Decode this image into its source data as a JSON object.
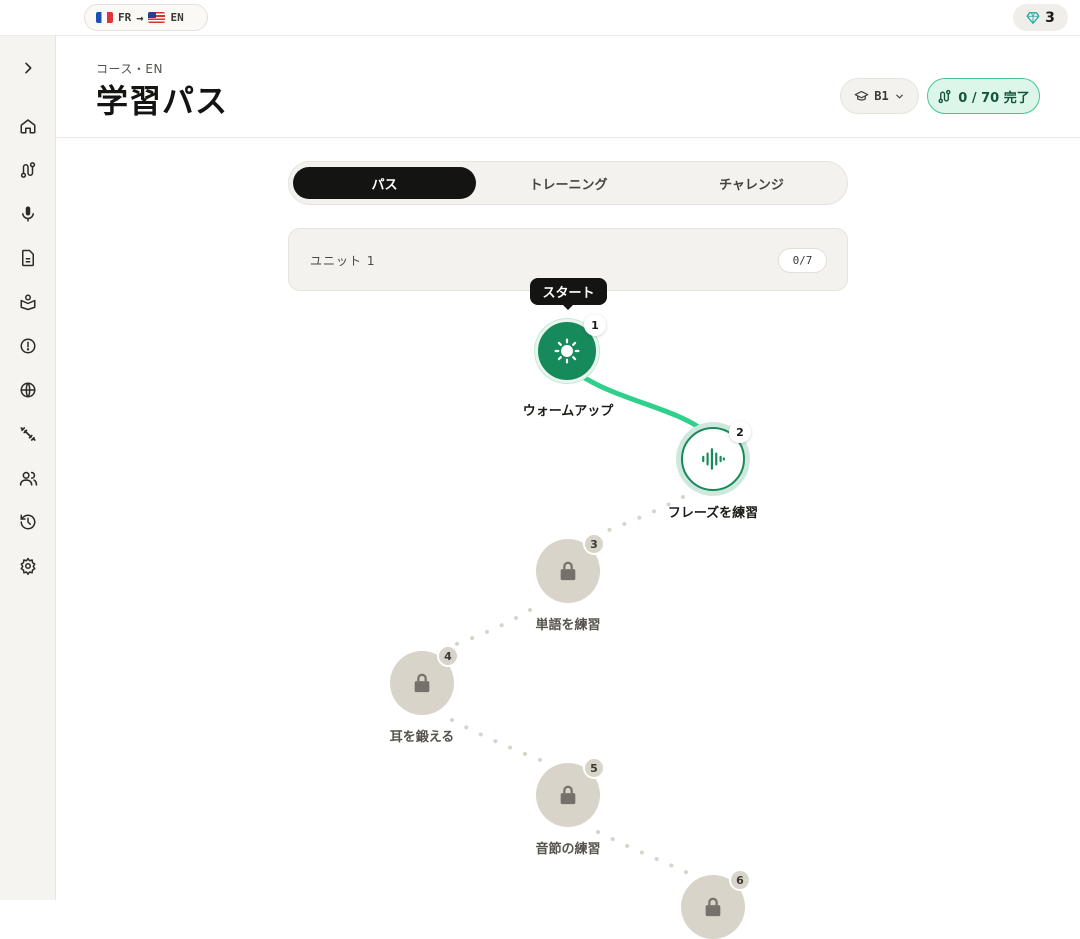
{
  "topbar": {
    "source_lang": "FR",
    "target_lang": "EN",
    "arrow": "→",
    "gems_count": "3"
  },
  "sidebar": {
    "items": [
      {
        "icon": "chevron-right-icon"
      },
      {
        "icon": "home-icon"
      },
      {
        "icon": "path-icon"
      },
      {
        "icon": "microphone-icon"
      },
      {
        "icon": "document-icon"
      },
      {
        "icon": "book-icon"
      },
      {
        "icon": "alert-icon"
      },
      {
        "icon": "globe-icon"
      },
      {
        "icon": "dumbbell-icon"
      },
      {
        "icon": "users-icon"
      },
      {
        "icon": "history-icon"
      },
      {
        "icon": "gear-icon"
      }
    ]
  },
  "header": {
    "breadcrumb": "コース・EN",
    "title": "学習パス",
    "level": "B1",
    "progress": "0 / 70 完了"
  },
  "tabs": [
    {
      "label": "パス",
      "active": true
    },
    {
      "label": "トレーニング",
      "active": false
    },
    {
      "label": "チャレンジ",
      "active": false
    }
  ],
  "unit": {
    "title": "ユニット 1",
    "count": "0/7"
  },
  "path": {
    "start_label": "スタート",
    "nodes": [
      {
        "number": "1",
        "label": "ウォームアップ",
        "state": "done",
        "icon": "sun-icon"
      },
      {
        "number": "2",
        "label": "フレーズを練習",
        "state": "current",
        "icon": "waveform-icon"
      },
      {
        "number": "3",
        "label": "単語を練習",
        "state": "locked",
        "icon": "lock-icon"
      },
      {
        "number": "4",
        "label": "耳を鍛える",
        "state": "locked",
        "icon": "lock-icon"
      },
      {
        "number": "5",
        "label": "音節の練習",
        "state": "locked",
        "icon": "lock-icon"
      },
      {
        "number": "6",
        "label": "",
        "state": "locked",
        "icon": "lock-icon"
      }
    ]
  },
  "colors": {
    "accent": "#178a5b",
    "accent_light": "#dcf7ea",
    "locked": "#d8d4ca",
    "dark": "#141412"
  }
}
